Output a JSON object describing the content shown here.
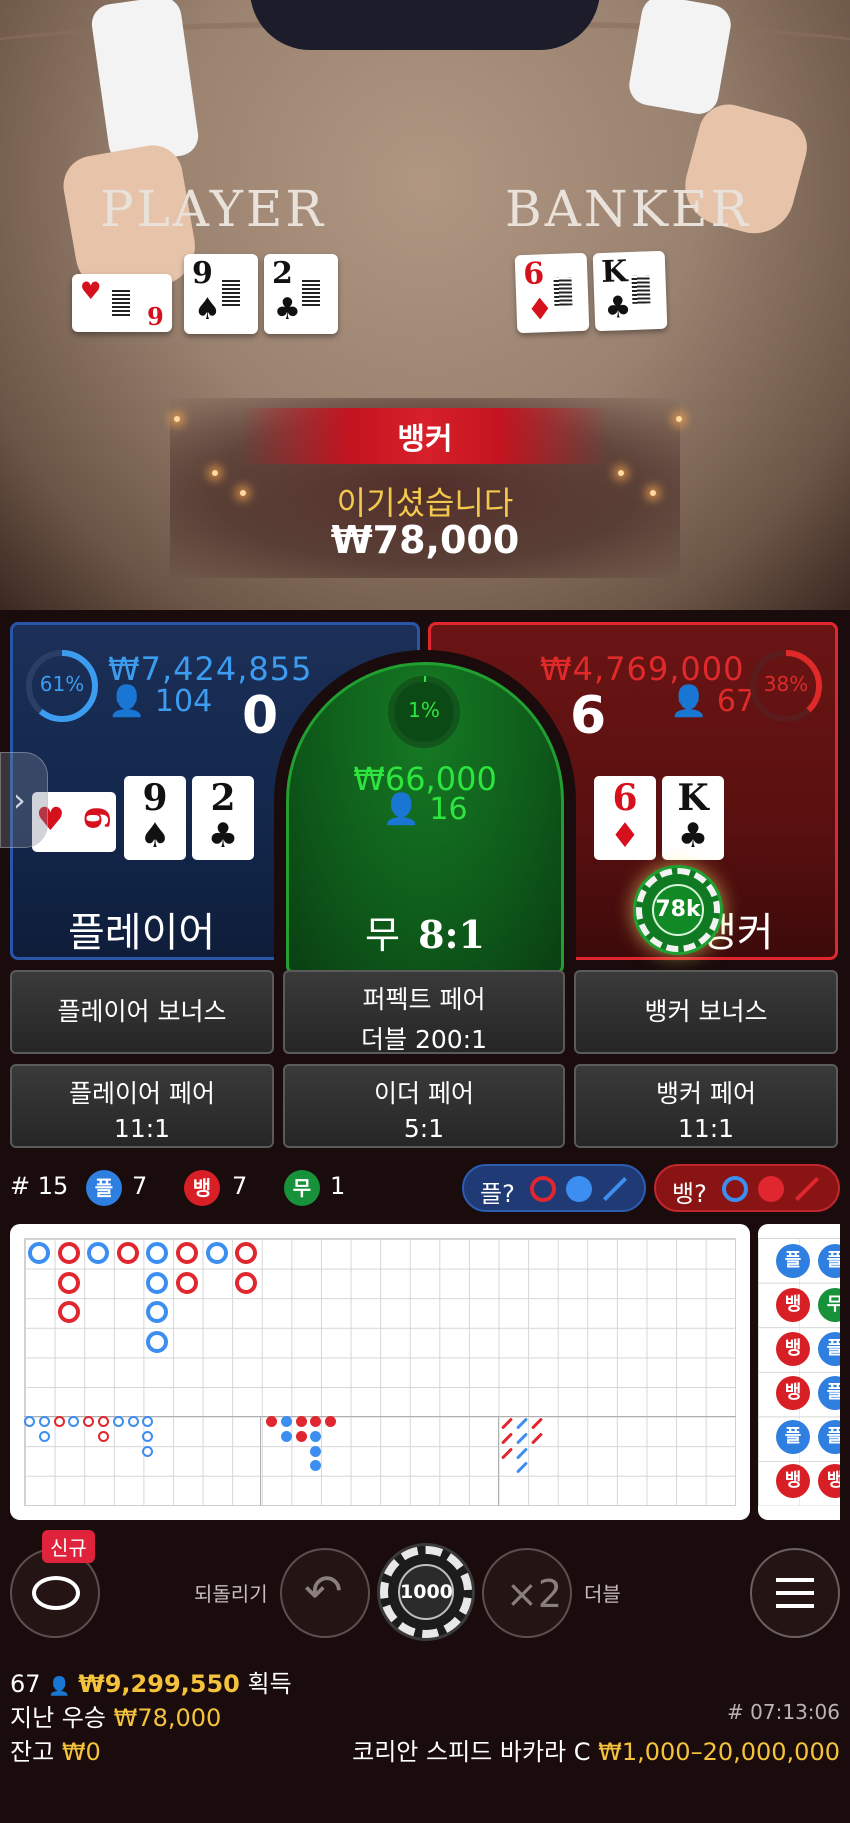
{
  "result": {
    "winner_label": "뱅커",
    "message": "이기셨습니다",
    "amount": "₩78,000"
  },
  "felt": {
    "player_word": "PLAYER",
    "banker_word": "BANKER"
  },
  "dealt_cards": {
    "player": [
      {
        "rank": "6",
        "suit": "♥",
        "color": "red"
      },
      {
        "rank": "9",
        "suit": "♠",
        "color": "black"
      },
      {
        "rank": "2",
        "suit": "♣",
        "color": "black"
      }
    ],
    "banker": [
      {
        "rank": "6",
        "suit": "♦",
        "color": "red"
      },
      {
        "rank": "K",
        "suit": "♣",
        "color": "black"
      }
    ]
  },
  "player": {
    "percent": "61%",
    "total_bet": "₩7,424,855",
    "bettors": "104",
    "score": "0",
    "label": "플레이어",
    "cards": [
      {
        "rank": "6",
        "suit": "♥",
        "color": "red"
      },
      {
        "rank": "9",
        "suit": "♠",
        "color": "black"
      },
      {
        "rank": "2",
        "suit": "♣",
        "color": "black"
      }
    ],
    "accent": "#3c9cf0"
  },
  "tie": {
    "percent": "1%",
    "total_bet": "₩66,000",
    "bettors": "16",
    "label": "무",
    "odds": "8:1",
    "accent": "#2ee43e"
  },
  "banker": {
    "percent": "38%",
    "total_bet": "₩4,769,000",
    "bettors": "67",
    "score": "6",
    "label": "뱅커",
    "cards": [
      {
        "rank": "6",
        "suit": "♦",
        "color": "red"
      },
      {
        "rank": "K",
        "suit": "♣",
        "color": "black"
      }
    ],
    "chip": "78k",
    "accent": "#e02a2a"
  },
  "side_bets": [
    {
      "id": "player-bonus",
      "line1": "플레이어 보너스",
      "line2": ""
    },
    {
      "id": "perfect-pair",
      "line1": "퍼펙트 페어",
      "line2": "더블 200:1"
    },
    {
      "id": "banker-bonus",
      "line1": "뱅커 보너스",
      "line2": ""
    },
    {
      "id": "player-pair",
      "line1": "플레이어 페어",
      "line2": "11:1"
    },
    {
      "id": "either-pair",
      "line1": "이더 페어",
      "line2": "5:1"
    },
    {
      "id": "banker-pair",
      "line1": "뱅커 페어",
      "line2": "11:1"
    }
  ],
  "stats": {
    "round": "# 15",
    "player_short": "플",
    "player_count": "7",
    "banker_short": "뱅",
    "banker_count": "7",
    "tie_short": "무",
    "tie_count": "1",
    "player_predict": "플?",
    "banker_predict": "뱅?"
  },
  "bead_road": [
    "플",
    "뱅",
    "뱅",
    "뱅",
    "플",
    "뱅"
  ],
  "bead_road_col2": [
    "플",
    "무",
    "플",
    "플",
    "플",
    "뱅"
  ],
  "controls": {
    "new_badge": "신규",
    "undo_label": "되돌리기",
    "chip_value": "1000",
    "double_icon": "×2",
    "double_label": "더블",
    "menu_icon": "hamburger-icon"
  },
  "footer": {
    "players_online": "67",
    "total_won": "₩9,299,550",
    "won_label": "획득",
    "last_win_label": "지난 우승",
    "last_win": "₩78,000",
    "balance_label": "잔고",
    "balance": "₩0",
    "game_id": "# 07:13:06",
    "table_name": "코리안 스피드 바카라 C",
    "limits": "₩1,000–20,000,000"
  },
  "colors": {
    "player_blue": "#3c9cf0",
    "banker_red": "#e02a2a",
    "tie_green": "#2ee43e",
    "gold": "#f5c33b"
  }
}
